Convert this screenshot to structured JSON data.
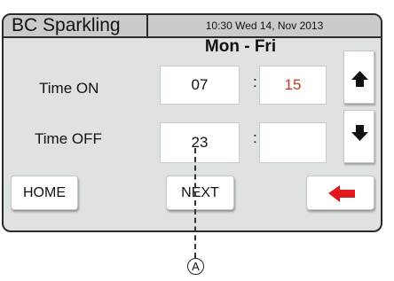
{
  "header": {
    "title": "BC Sparkling",
    "datetime": "10:30 Wed 14, Nov 2013"
  },
  "schedule": {
    "day_range": "Mon - Fri",
    "time_on": {
      "label": "Time ON",
      "hour": "07",
      "separator": ":",
      "minute": "15",
      "minute_color": "#c0392b"
    },
    "time_off": {
      "label": "Time OFF",
      "hour": "23",
      "separator": ":",
      "minute": ""
    }
  },
  "buttons": {
    "home": "HOME",
    "next": "NEXT",
    "up_icon": "arrow-up-icon",
    "down_icon": "arrow-down-icon",
    "back_icon": "red-left-arrow-icon"
  },
  "callout": {
    "label": "A"
  },
  "colors": {
    "screen_bg": "#dfe2e2",
    "titlebar_bg": "#c9cccc",
    "border": "#2b2b2b",
    "back_arrow": "#e3181f"
  }
}
